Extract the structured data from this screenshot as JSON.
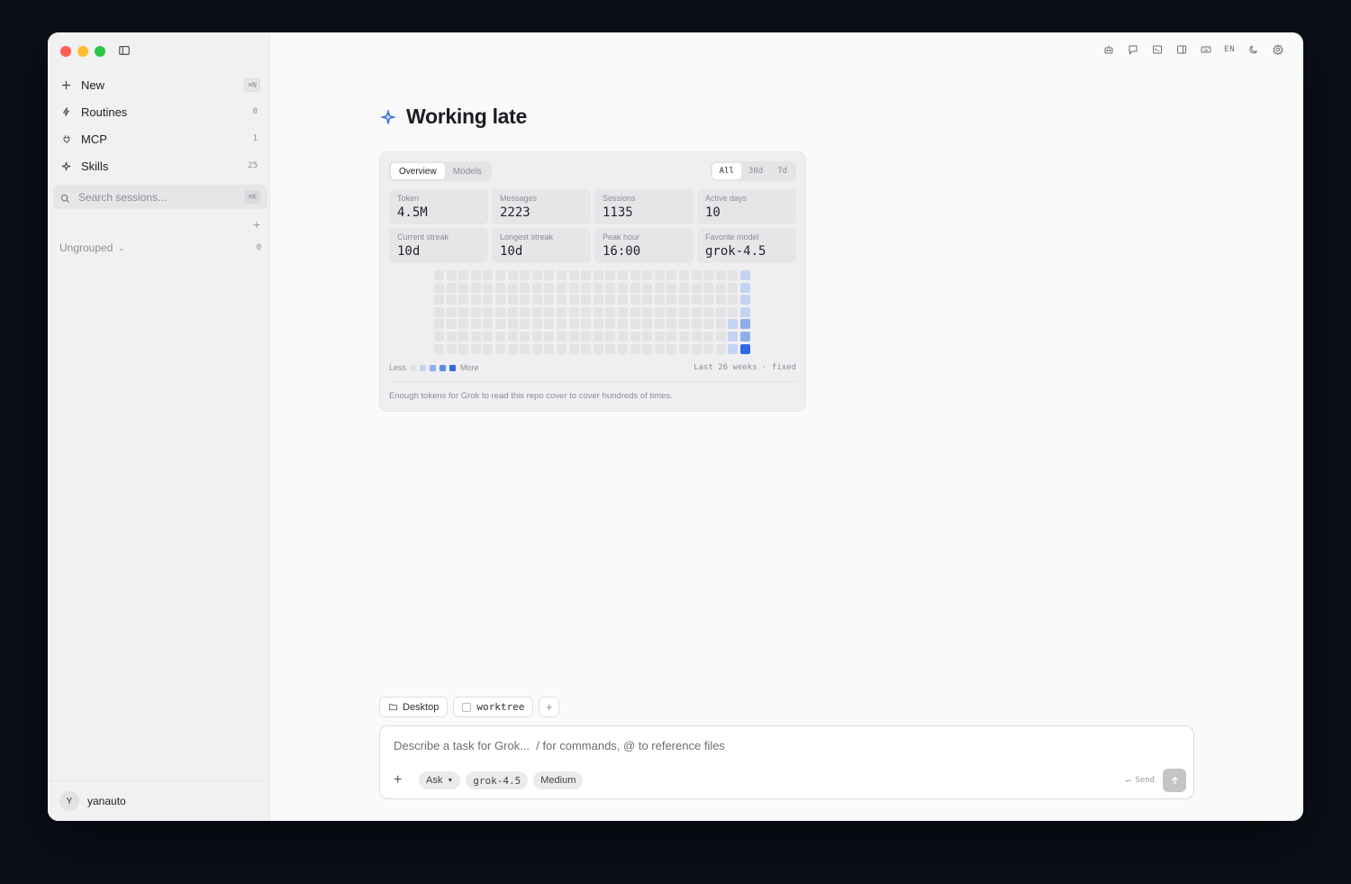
{
  "sidebar": {
    "items": [
      {
        "label": "New",
        "icon": "plus-icon",
        "shortcut": "⌘N"
      },
      {
        "label": "Routines",
        "icon": "bolt-icon",
        "count": "0"
      },
      {
        "label": "MCP",
        "icon": "plug-icon",
        "count": "1"
      },
      {
        "label": "Skills",
        "icon": "sparkle-icon",
        "count": "25"
      }
    ],
    "search": {
      "placeholder": "Search sessions...",
      "shortcut": "⌘K"
    },
    "add_label": "+",
    "group": {
      "label": "Ungrouped",
      "count": "0"
    },
    "user": {
      "initial": "Y",
      "name": "yanauto"
    }
  },
  "topbar": {
    "lang": "EN"
  },
  "main": {
    "title": "Working late",
    "card": {
      "tabs": [
        "Overview",
        "Models"
      ],
      "ranges": [
        "All",
        "30d",
        "7d"
      ],
      "stats": [
        {
          "label": "Token",
          "value": "4.5M"
        },
        {
          "label": "Messages",
          "value": "2223"
        },
        {
          "label": "Sessions",
          "value": "1135"
        },
        {
          "label": "Active days",
          "value": "10"
        },
        {
          "label": "Current streak",
          "value": "10d"
        },
        {
          "label": "Longest streak",
          "value": "10d"
        },
        {
          "label": "Peak hour",
          "value": "16:00"
        },
        {
          "label": "Favorite model",
          "value": "grok-4.5"
        }
      ],
      "heatmap": {
        "weeks": 26,
        "days": 7,
        "last_week_levels": [
          1,
          1,
          1,
          1,
          2,
          2,
          4
        ],
        "prev_week_levels": [
          0,
          0,
          0,
          0,
          1,
          1,
          1
        ],
        "colors": [
          "#e3e3e6",
          "#c4d3f1",
          "#8eaee9",
          "#5f8de6",
          "#2f6be3"
        ]
      },
      "legend": {
        "less": "Less",
        "more": "More",
        "right": "Last 26 weeks · fixed"
      },
      "note": "Enough tokens for Grok to read this repo cover to cover hundreds of times."
    },
    "chips": {
      "folder": "Desktop",
      "worktree": "worktree",
      "add": "+"
    },
    "composer": {
      "placeholder": "Describe a task for Grok...  / for commands, @ to reference files",
      "add": "+",
      "mode": "Ask",
      "model": "grok-4.5",
      "effort": "Medium",
      "send_hint": "↵ Send"
    }
  }
}
